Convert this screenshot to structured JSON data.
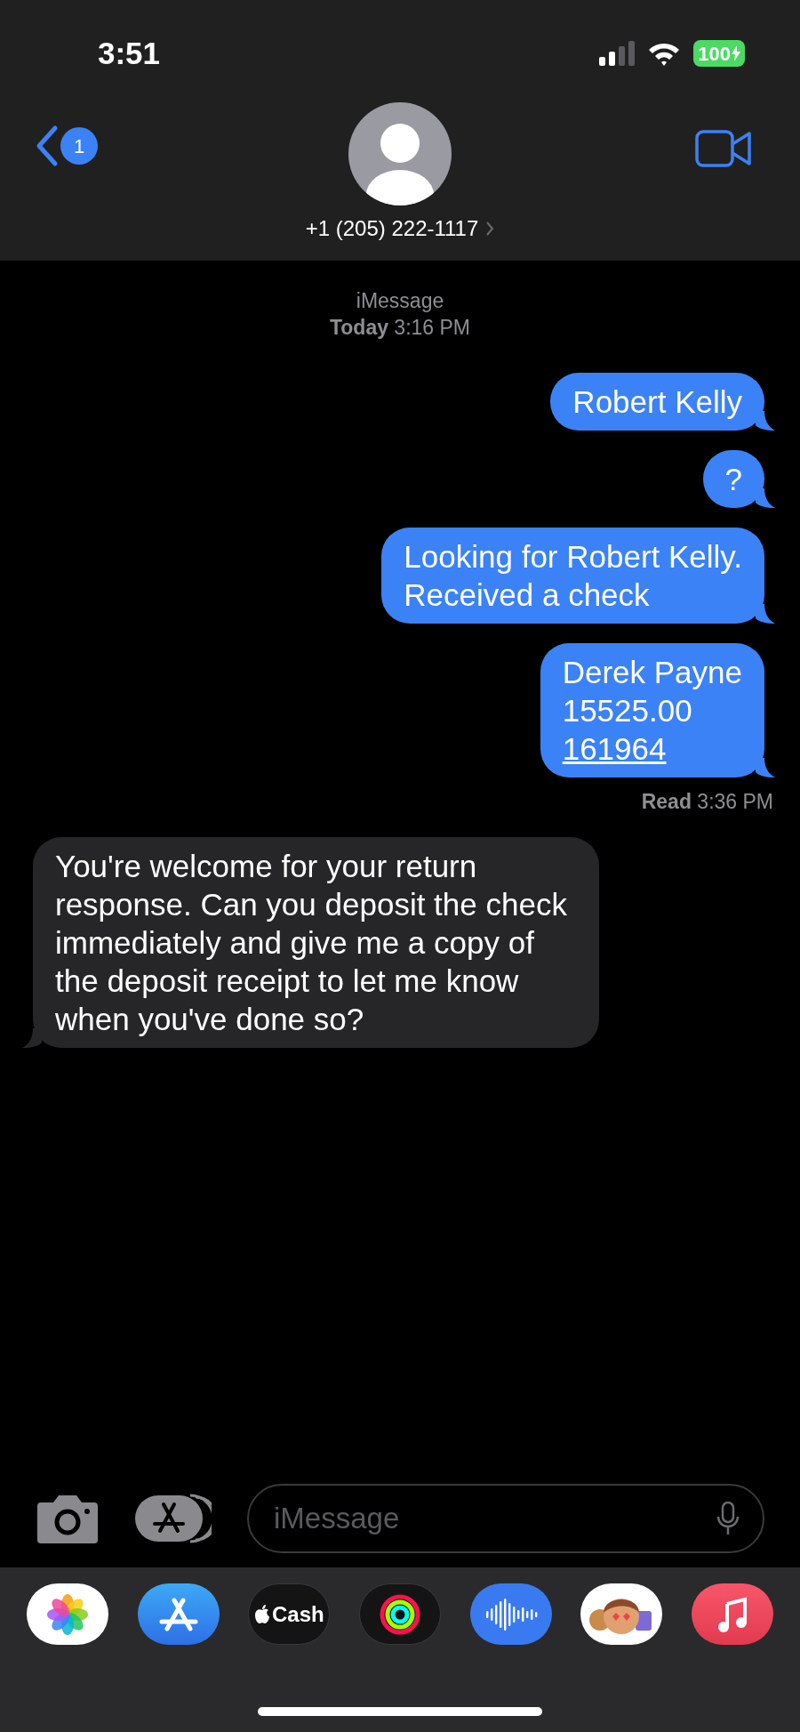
{
  "status_bar": {
    "time": "3:51",
    "battery": "100"
  },
  "header": {
    "back_badge": "1",
    "contact": "+1 (205) 222-1117"
  },
  "conversation": {
    "service": "iMessage",
    "timestamp": "**Today** 3:16 PM",
    "messages": [
      {
        "outgoing": true,
        "text": "Robert Kelly"
      },
      {
        "outgoing": true,
        "text": "?"
      },
      {
        "outgoing": true,
        "text": "Looking for Robert Kelly.\nReceived a check"
      },
      {
        "outgoing": true,
        "text": "Derek Payne\n15525.00",
        "link": "161964",
        "receipt": "**Read** 3:36 PM"
      },
      {
        "outgoing": false,
        "text": "You're welcome for your return response. Can you deposit the check immediately and give me a copy of the deposit receipt to let me know when you've done so?"
      }
    ]
  },
  "composer": {
    "placeholder": "iMessage"
  },
  "app_drawer": [
    {
      "kind": "photos"
    },
    {
      "kind": "appstore"
    },
    {
      "kind": "cash",
      "label": "Cash"
    },
    {
      "kind": "activity"
    },
    {
      "kind": "audio"
    },
    {
      "kind": "memoji"
    },
    {
      "kind": "music"
    }
  ]
}
